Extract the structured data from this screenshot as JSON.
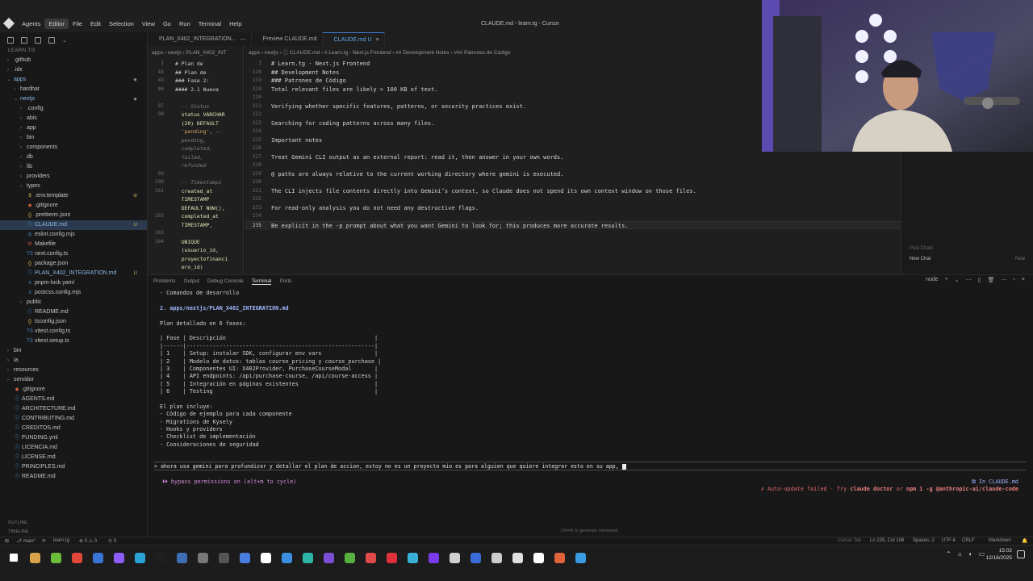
{
  "window": {
    "title": "CLAUDE.md - learn.tg - Cursor",
    "menu": [
      "Agents",
      "Editor",
      "File",
      "Edit",
      "Selection",
      "View",
      "Go",
      "Run",
      "Terminal",
      "Help"
    ]
  },
  "explorer": {
    "root": "LEARN.TG",
    "items": [
      {
        "indent": 0,
        "chev": "›",
        "icon": "",
        "name": ".github",
        "badge": "",
        "cls": "name"
      },
      {
        "indent": 0,
        "chev": "›",
        "icon": "",
        "name": ".idx",
        "badge": "",
        "cls": "name"
      },
      {
        "indent": 0,
        "chev": "⌄",
        "icon": "",
        "name": "apps",
        "badge": "●",
        "cls": "mod"
      },
      {
        "indent": 1,
        "chev": "›",
        "icon": "",
        "name": "hardhat",
        "badge": "",
        "cls": "name"
      },
      {
        "indent": 1,
        "chev": "⌄",
        "icon": "",
        "name": "nextjs",
        "badge": "●",
        "cls": "mod"
      },
      {
        "indent": 2,
        "chev": "›",
        "icon": "",
        "name": ".config",
        "badge": "",
        "cls": "name"
      },
      {
        "indent": 2,
        "chev": "›",
        "icon": "",
        "name": "abis",
        "badge": "",
        "cls": "name"
      },
      {
        "indent": 2,
        "chev": "›",
        "icon": "",
        "name": "app",
        "badge": "",
        "cls": "name"
      },
      {
        "indent": 2,
        "chev": "›",
        "icon": "",
        "name": "bin",
        "badge": "",
        "cls": "name"
      },
      {
        "indent": 2,
        "chev": "›",
        "icon": "",
        "name": "components",
        "badge": "",
        "cls": "name"
      },
      {
        "indent": 2,
        "chev": "›",
        "icon": "",
        "name": "db",
        "badge": "",
        "cls": "name"
      },
      {
        "indent": 2,
        "chev": "›",
        "icon": "",
        "name": "lib",
        "badge": "",
        "cls": "name"
      },
      {
        "indent": 2,
        "chev": "›",
        "icon": "",
        "name": "providers",
        "badge": "",
        "cls": "name"
      },
      {
        "indent": 2,
        "chev": "›",
        "icon": "",
        "name": "types",
        "badge": "",
        "cls": "name"
      },
      {
        "indent": 2,
        "chev": "",
        "icon": "$",
        "name": ".env.template",
        "badge": "⊘",
        "cls": "name"
      },
      {
        "indent": 2,
        "chev": "",
        "icon": "◆",
        "name": ".gitignore",
        "badge": "",
        "cls": "name"
      },
      {
        "indent": 2,
        "chev": "",
        "icon": "{}",
        "name": ".prettierrc.json",
        "badge": "",
        "cls": "name"
      },
      {
        "indent": 2,
        "chev": "",
        "icon": "ⓘ",
        "name": "CLAUDE.md",
        "badge": "U",
        "cls": "mod"
      },
      {
        "indent": 2,
        "chev": "",
        "icon": "◎",
        "name": "eslint.config.mjs",
        "badge": "",
        "cls": "name"
      },
      {
        "indent": 2,
        "chev": "",
        "icon": "M",
        "name": "Makefile",
        "badge": "",
        "cls": "name"
      },
      {
        "indent": 2,
        "chev": "",
        "icon": "TS",
        "name": "next.config.ts",
        "badge": "",
        "cls": "name"
      },
      {
        "indent": 2,
        "chev": "",
        "icon": "{}",
        "name": "package.json",
        "badge": "",
        "cls": "name"
      },
      {
        "indent": 2,
        "chev": "",
        "icon": "ⓘ",
        "name": "PLAN_X402_INTEGRATION.md",
        "badge": "U",
        "cls": "mod"
      },
      {
        "indent": 2,
        "chev": "",
        "icon": "≡",
        "name": "pnpm-lock.yaml",
        "badge": "",
        "cls": "name"
      },
      {
        "indent": 2,
        "chev": "",
        "icon": "≡",
        "name": "postcss.config.mjs",
        "badge": "",
        "cls": "name"
      },
      {
        "indent": 2,
        "chev": "›",
        "icon": "",
        "name": "public",
        "badge": "",
        "cls": "name"
      },
      {
        "indent": 2,
        "chev": "",
        "icon": "ⓘ",
        "name": "README.md",
        "badge": "",
        "cls": "name"
      },
      {
        "indent": 2,
        "chev": "",
        "icon": "{}",
        "name": "tsconfig.json",
        "badge": "",
        "cls": "name"
      },
      {
        "indent": 2,
        "chev": "",
        "icon": "TS",
        "name": "vitest.config.ts",
        "badge": "",
        "cls": "name"
      },
      {
        "indent": 2,
        "chev": "",
        "icon": "TS",
        "name": "vitest.setup.ts",
        "badge": "",
        "cls": "name"
      },
      {
        "indent": 0,
        "chev": "›",
        "icon": "",
        "name": "bin",
        "badge": "",
        "cls": "name"
      },
      {
        "indent": 0,
        "chev": "›",
        "icon": "",
        "name": "ia",
        "badge": "",
        "cls": "name"
      },
      {
        "indent": 0,
        "chev": "›",
        "icon": "",
        "name": "resources",
        "badge": "",
        "cls": "name"
      },
      {
        "indent": 0,
        "chev": "›",
        "icon": "",
        "name": "servidor",
        "badge": "",
        "cls": "name"
      },
      {
        "indent": 0,
        "chev": "",
        "icon": "◆",
        "name": ".gitignore",
        "badge": "",
        "cls": "name"
      },
      {
        "indent": 0,
        "chev": "",
        "icon": "ⓘ",
        "name": "AGENTS.md",
        "badge": "",
        "cls": "name"
      },
      {
        "indent": 0,
        "chev": "",
        "icon": "ⓘ",
        "name": "ARCHITECTURE.md",
        "badge": "",
        "cls": "name"
      },
      {
        "indent": 0,
        "chev": "",
        "icon": "ⓘ",
        "name": "CONTRIBUTING.md",
        "badge": "",
        "cls": "name"
      },
      {
        "indent": 0,
        "chev": "",
        "icon": "ⓘ",
        "name": "CREDITOS.md",
        "badge": "",
        "cls": "name"
      },
      {
        "indent": 0,
        "chev": "",
        "icon": "ⓘ",
        "name": "FUNDING.yml",
        "badge": "",
        "cls": "name"
      },
      {
        "indent": 0,
        "chev": "",
        "icon": "ⓘ",
        "name": "LICENCIA.md",
        "badge": "",
        "cls": "name"
      },
      {
        "indent": 0,
        "chev": "",
        "icon": "ⓘ",
        "name": "LICENSE.md",
        "badge": "",
        "cls": "name"
      },
      {
        "indent": 0,
        "chev": "",
        "icon": "ⓘ",
        "name": "PRINCIPLES.md",
        "badge": "",
        "cls": "name"
      },
      {
        "indent": 0,
        "chev": "",
        "icon": "ⓘ",
        "name": "README.md",
        "badge": "",
        "cls": "name"
      }
    ],
    "footer": [
      "OUTLINE",
      "TIMELINE"
    ]
  },
  "tabs": [
    {
      "label": "PLAN_X402_INTEGRATION...",
      "extra": "⋯",
      "active": false
    },
    {
      "label": "Preview CLAUDE.md",
      "extra": "",
      "active": false
    },
    {
      "label": "CLAUDE.md U",
      "extra": "×",
      "active": true
    }
  ],
  "left_pane": {
    "breadcrumb": "apps › nextjs › PLAN_X402_INT",
    "lines": [
      {
        "num": "1",
        "text": "# Plan de",
        "cls": ""
      },
      {
        "num": "48",
        "text": "## Plan de",
        "cls": ""
      },
      {
        "num": "49",
        "text": "### Fase 2:",
        "cls": ""
      },
      {
        "num": "86",
        "text": "#### 2.1 Nueva",
        "cls": ""
      },
      {
        "num": "",
        "text": "",
        "cls": ""
      },
      {
        "num": "97",
        "text": "  -- Status",
        "cls": "cmt"
      },
      {
        "num": "98",
        "text": "  status VARCHAR",
        "cls": "sql"
      },
      {
        "num": "",
        "text": "  (20) DEFAULT",
        "cls": "sql"
      },
      {
        "num": "",
        "text": "  'pending', --",
        "cls": "str"
      },
      {
        "num": "",
        "text": "  pending,",
        "cls": "cmt"
      },
      {
        "num": "",
        "text": "  completed,",
        "cls": "cmt"
      },
      {
        "num": "",
        "text": "  failed,",
        "cls": "cmt"
      },
      {
        "num": "",
        "text": "  refunded",
        "cls": "cmt"
      },
      {
        "num": "99",
        "text": "",
        "cls": ""
      },
      {
        "num": "100",
        "text": "  -- Timestamps",
        "cls": "cmt"
      },
      {
        "num": "101",
        "text": "  created_at",
        "cls": "sql"
      },
      {
        "num": "",
        "text": "  TIMESTAMP",
        "cls": "sql"
      },
      {
        "num": "",
        "text": "  DEFAULT NOW(),",
        "cls": "sql"
      },
      {
        "num": "102",
        "text": "  completed_at",
        "cls": "sql"
      },
      {
        "num": "",
        "text": "  TIMESTAMP,",
        "cls": "sql"
      },
      {
        "num": "103",
        "text": "",
        "cls": ""
      },
      {
        "num": "104",
        "text": "  UNIQUE",
        "cls": "sql"
      },
      {
        "num": "",
        "text": "  (usuario_id,",
        "cls": "sql"
      },
      {
        "num": "",
        "text": "  proyectofinanci",
        "cls": "sql"
      },
      {
        "num": "",
        "text": "  ero_id)",
        "cls": "sql"
      }
    ]
  },
  "right_pane": {
    "breadcrumb": "apps › nextjs › ⓘ CLAUDE.md › # Learn.tg - Next.js Frontend › ## Development Notes › ### Patrones de Código",
    "lines": [
      {
        "num": "3",
        "text": "# Learn.tg - Next.js Frontend",
        "cur": false
      },
      {
        "num": "124",
        "text": "## Development Notes",
        "cur": false
      },
      {
        "num": "133",
        "text": "### Patrones de Código",
        "cur": false
      },
      {
        "num": "219",
        "text": "Total relevant files are likely > 100 KB of text.",
        "cur": false
      },
      {
        "num": "220",
        "text": "",
        "cur": false
      },
      {
        "num": "221",
        "text": "Verifying whether specific features, patterns, or security practices exist.",
        "cur": false
      },
      {
        "num": "222",
        "text": "",
        "cur": false
      },
      {
        "num": "223",
        "text": "Searching for coding patterns across many files.",
        "cur": false
      },
      {
        "num": "224",
        "text": "",
        "cur": false
      },
      {
        "num": "225",
        "text": "Important notes",
        "cur": false
      },
      {
        "num": "226",
        "text": "",
        "cur": false
      },
      {
        "num": "227",
        "text": "Treat Gemini CLI output as an external report: read it, then answer in your own words.",
        "cur": false
      },
      {
        "num": "228",
        "text": "",
        "cur": false
      },
      {
        "num": "229",
        "text": "@ paths are always relative to the current working directory where gemini is executed.",
        "cur": false
      },
      {
        "num": "230",
        "text": "",
        "cur": false
      },
      {
        "num": "231",
        "text": "The CLI injects file contents directly into Gemini’s context, so Claude does not spend its own context window on those files.",
        "cur": false
      },
      {
        "num": "232",
        "text": "",
        "cur": false
      },
      {
        "num": "233",
        "text": "For read-only analysis you do not need any destructive flags.",
        "cur": false
      },
      {
        "num": "234",
        "text": "",
        "cur": false
      },
      {
        "num": "235",
        "text": "Be explicit in the -p prompt about what you want Gemini to look for; this produces more accurate results.",
        "cur": true
      }
    ]
  },
  "chat": {
    "past_label": "Past Chats",
    "new_chat": "New Chat",
    "time": "Now"
  },
  "panel": {
    "tabs": [
      "Problems",
      "Output",
      "Debug Console",
      "Terminal",
      "Ports"
    ],
    "active_tab": "Terminal",
    "terminal_name": "node",
    "terminal": [
      {
        "text": "- Comandos de desarrollo",
        "cls": ""
      },
      {
        "text": "",
        "cls": ""
      },
      {
        "text": "2. apps/nextjs/PLAN_X402_INTEGRATION.md",
        "cls": "bold blue"
      },
      {
        "text": "",
        "cls": ""
      },
      {
        "text": "Plan detallado en 6 fases:",
        "cls": ""
      },
      {
        "text": "",
        "cls": ""
      },
      {
        "text": "| Fase | Descripción                                             |",
        "cls": ""
      },
      {
        "text": "|------|---------------------------------------------------------|",
        "cls": ""
      },
      {
        "text": "| 1    | Setup: instalar SDK, configurar env vars                |",
        "cls": ""
      },
      {
        "text": "| 2    | Modelo de datos: tablas course_pricing y course_purchase |",
        "cls": ""
      },
      {
        "text": "| 3    | Componentes UI: X402Provider, PurchaseCourseModal       |",
        "cls": ""
      },
      {
        "text": "| 4    | API endpoints: /api/purchase-course, /api/course-access |",
        "cls": ""
      },
      {
        "text": "| 5    | Integración en páginas existentes                       |",
        "cls": ""
      },
      {
        "text": "| 6    | Testing                                                 |",
        "cls": ""
      },
      {
        "text": "",
        "cls": ""
      },
      {
        "text": "El plan incluye:",
        "cls": ""
      },
      {
        "text": "- Código de ejemplo para cada componente",
        "cls": ""
      },
      {
        "text": "- Migrations de Kysely",
        "cls": ""
      },
      {
        "text": "- Hooks y providers",
        "cls": ""
      },
      {
        "text": "- Checklist de implementación",
        "cls": ""
      },
      {
        "text": "- Consideraciones de seguridad",
        "cls": ""
      }
    ],
    "prompt": "> ahora usa gemini para profundizar y detallar el plan de accion, estoy no es un proyecto mio es para alguien que quiere integrar esto en su app, ",
    "bypass": "⏵⏵ bypass permissions on (alt+m to cycle)",
    "in_file": "⧉ In CLAUDE.md",
    "autoupdate_prefix": "✗ Auto-update failed · Try ",
    "autoupdate_cmd1": "claude doctor",
    "autoupdate_mid": " or ",
    "autoupdate_cmd2": "npm i -g @anthropic-ai/claude-code",
    "generate_hint": "Ctrl+K to generate command"
  },
  "status": {
    "branch": "⎇ main*",
    "sync": "⟳",
    "project": "learn.tg",
    "errors": "⊗ 0 ⚠ 0",
    "ports": "⊙ 0",
    "cursor_tab": "Cursor Tab",
    "position": "Ln 235, Col 106",
    "spaces": "Spaces: 2",
    "encoding": "UTF-8",
    "eol": "CRLF",
    "language": "Markdown"
  },
  "taskbar": {
    "time": "15:02",
    "date": "12/16/2025",
    "icon_colors": [
      "#ffffff",
      "#d6a24a",
      "#6bbd3a",
      "#e2463b",
      "#3a73d6",
      "#8b5cf6",
      "#2aa3d6",
      "#1f1f1f",
      "#3f6fb3",
      "#777777",
      "#555555",
      "#4b7de0",
      "#ffffff",
      "#3b8ee0",
      "#2bb6a8",
      "#7a4fd6",
      "#58b040",
      "#e04a4a",
      "#e0313b",
      "#38b0d8",
      "#7c3aed",
      "#d0d0d0",
      "#3a6bd6",
      "#cccccc",
      "#e0e0e0",
      "#ffffff",
      "#e0623b",
      "#3a9be0"
    ]
  }
}
